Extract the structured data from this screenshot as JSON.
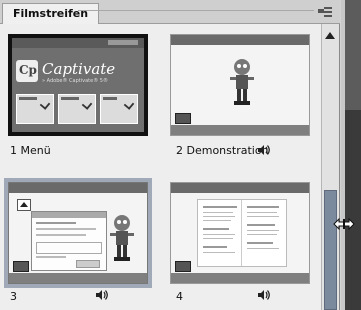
{
  "tab": {
    "label": "Filmstreifen"
  },
  "slides": [
    {
      "label": "1 Menü",
      "has_audio": false,
      "selected": false,
      "brand_title": "Captivate",
      "brand_sub": "» Adobe® Captivate® 5®"
    },
    {
      "label": "2 Demonstration",
      "has_audio": true,
      "selected": false
    },
    {
      "label": "3",
      "has_audio": true,
      "selected": true
    },
    {
      "label": "4",
      "has_audio": true,
      "selected": false
    }
  ],
  "icons": {
    "panel_menu": "panel-menu-icon",
    "audio": "speaker-icon",
    "resize": "horizontal-resize-cursor-icon",
    "scroll_up": "scroll-up-arrow-icon",
    "slide_object": "slide-object-icon"
  },
  "colors": {
    "selection": "#9fa9b8",
    "slide_bg_dark": "#6e6e6e",
    "scroll_thumb": "#7c8a9e"
  }
}
